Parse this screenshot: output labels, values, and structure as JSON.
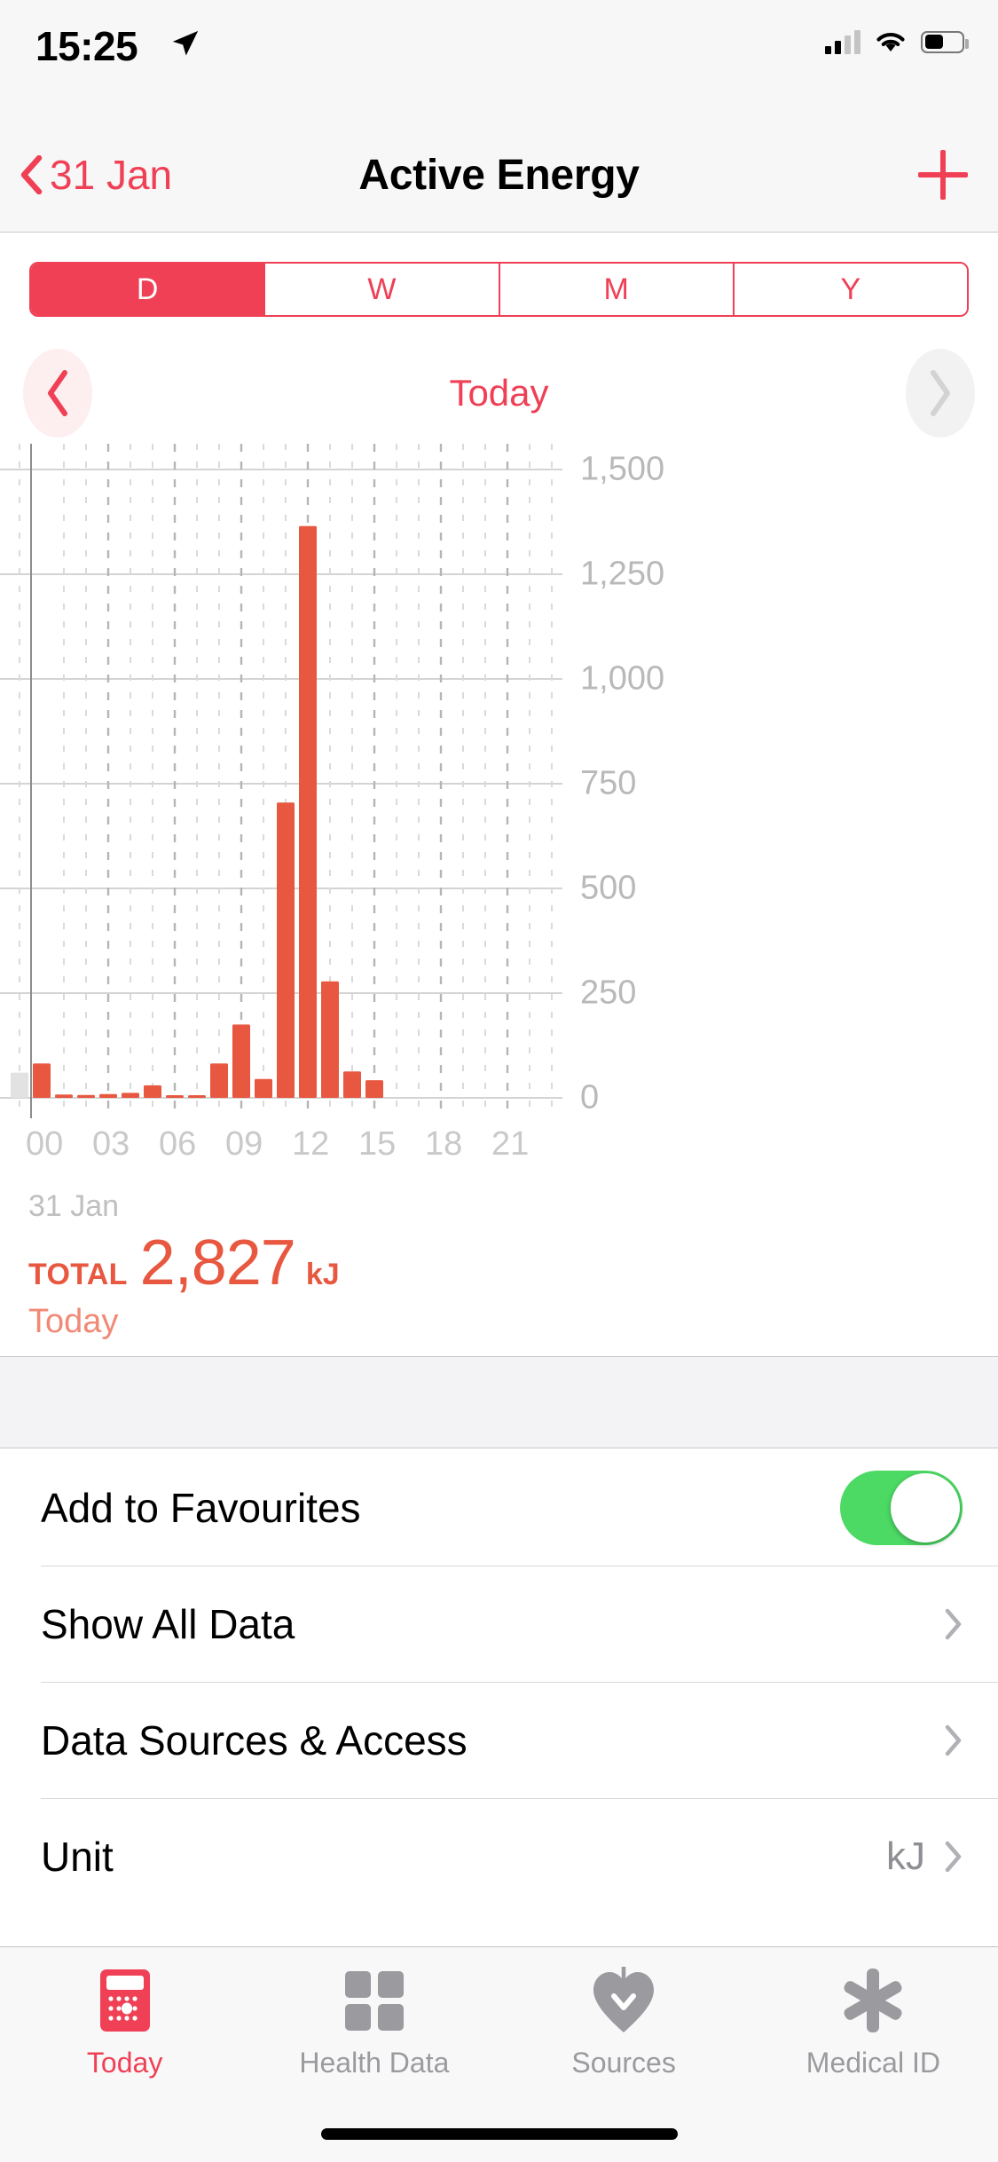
{
  "status_bar": {
    "time": "15:25",
    "location_icon": "location-arrow-icon",
    "signal_icon": "cellular-signal-icon",
    "wifi_icon": "wifi-icon",
    "battery_icon": "battery-icon"
  },
  "nav": {
    "back_label": "31 Jan",
    "back_icon": "chevron-left-icon",
    "title": "Active Energy",
    "add_icon": "plus-icon"
  },
  "segmented": {
    "options": [
      "D",
      "W",
      "M",
      "Y"
    ],
    "selected": "D",
    "accent_color": "#ef4056"
  },
  "date_nav": {
    "label": "Today",
    "prev_icon": "chevron-left-icon",
    "next_icon": "chevron-right-icon",
    "prev_enabled": true,
    "next_enabled": false
  },
  "chart_data": {
    "type": "bar",
    "title": "Active Energy",
    "xlabel": "",
    "ylabel": "kJ",
    "date_label": "31 Jan",
    "ylim": [
      0,
      1500
    ],
    "yticks": [
      0,
      250,
      500,
      750,
      1000,
      1250,
      1500
    ],
    "ytick_labels": [
      "0",
      "250",
      "500",
      "750",
      "1,000",
      "1,250",
      "1,500"
    ],
    "xticks": [
      0,
      3,
      6,
      9,
      12,
      15,
      18,
      21
    ],
    "xtick_labels": [
      "00",
      "03",
      "06",
      "09",
      "12",
      "15",
      "18",
      "21"
    ],
    "grid": true,
    "bar_color": "#e8573f",
    "inactive_bar_color": "#e2e2e2",
    "x_unit": "hour",
    "categories": [
      "23",
      "00",
      "01",
      "02",
      "03",
      "04",
      "05",
      "06",
      "07",
      "08",
      "09",
      "10",
      "11",
      "12",
      "13",
      "14",
      "15"
    ],
    "values": [
      60,
      82,
      8,
      7,
      9,
      12,
      30,
      6,
      5,
      82,
      175,
      705,
      1365,
      278,
      63,
      42,
      0
    ],
    "hours": [
      {
        "hour": "23",
        "value": 60,
        "inactive": true
      },
      {
        "hour": "00",
        "value": 82
      },
      {
        "hour": "01",
        "value": 8
      },
      {
        "hour": "02",
        "value": 7
      },
      {
        "hour": "03",
        "value": 9
      },
      {
        "hour": "04",
        "value": 12
      },
      {
        "hour": "05",
        "value": 30
      },
      {
        "hour": "06",
        "value": 6
      },
      {
        "hour": "07",
        "value": 5
      },
      {
        "hour": "08",
        "value": 82
      },
      {
        "hour": "09",
        "value": 175
      },
      {
        "hour": "10",
        "value": 45
      },
      {
        "hour": "11",
        "value": 705
      },
      {
        "hour": "12",
        "value": 1365
      },
      {
        "hour": "13",
        "value": 278
      },
      {
        "hour": "14",
        "value": 63
      },
      {
        "hour": "15",
        "value": 42
      }
    ]
  },
  "total": {
    "kicker": "TOTAL",
    "value": "2,827",
    "unit": "kJ",
    "subtitle": "Today",
    "color": "#e8573f"
  },
  "list_rows": [
    {
      "label": "Add to Favourites",
      "control": "toggle",
      "toggle_on": true,
      "value": ""
    },
    {
      "label": "Show All Data",
      "control": "disclosure",
      "value": ""
    },
    {
      "label": "Data Sources & Access",
      "control": "disclosure",
      "value": ""
    },
    {
      "label": "Unit",
      "control": "disclosure",
      "value": "kJ"
    }
  ],
  "tab_bar": {
    "tabs": [
      {
        "label": "Today",
        "icon": "calendar-icon",
        "active": true
      },
      {
        "label": "Health Data",
        "icon": "grid-squares-icon",
        "active": false
      },
      {
        "label": "Sources",
        "icon": "heart-download-icon",
        "active": false
      },
      {
        "label": "Medical ID",
        "icon": "asterisk-medical-icon",
        "active": false
      }
    ],
    "active_color": "#ef4056",
    "inactive_color": "#9a9a9f"
  }
}
